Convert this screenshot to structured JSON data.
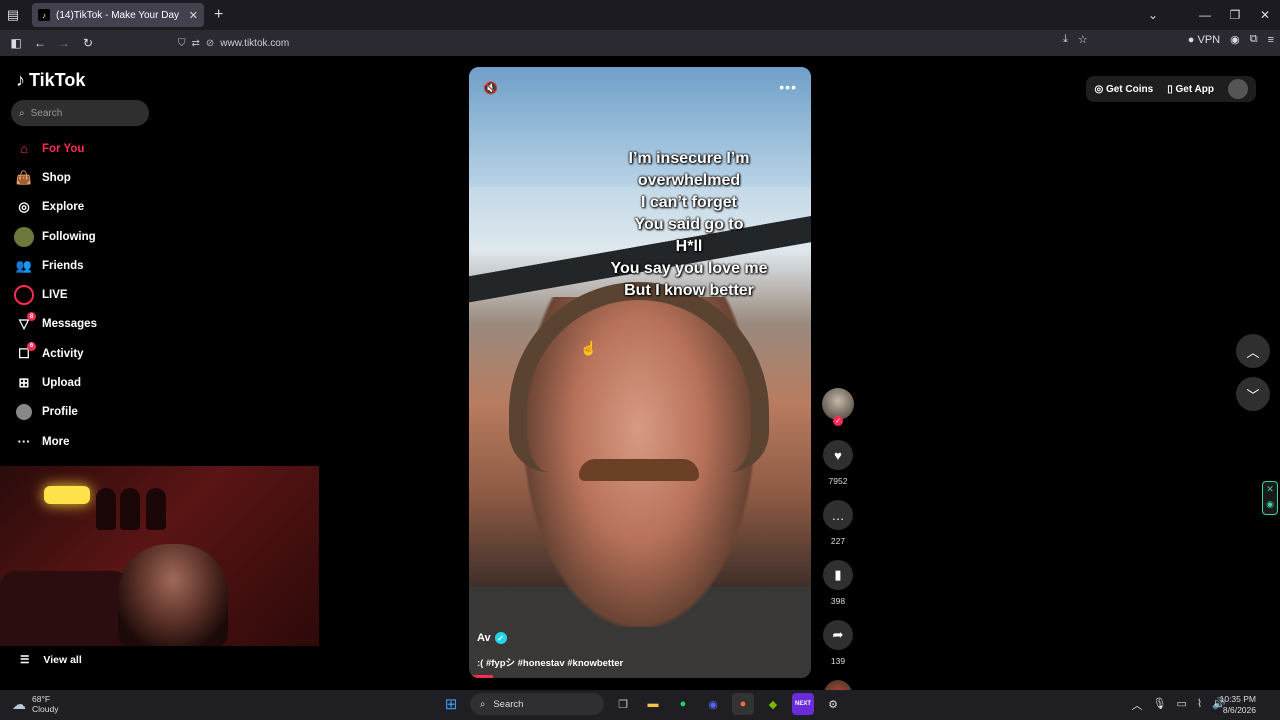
{
  "browser": {
    "tab_title": "(14)TikTok - Make Your Day",
    "url": "www.tiktok.com",
    "vpn_label": "VPN"
  },
  "sidebar": {
    "logo_text": "TikTok",
    "search_placeholder": "Search",
    "items": [
      {
        "label": "For You",
        "icon": "home-icon",
        "active": true
      },
      {
        "label": "Shop",
        "icon": "shop-bag-icon"
      },
      {
        "label": "Explore",
        "icon": "compass-icon"
      },
      {
        "label": "Following",
        "icon": "following-avatar-icon"
      },
      {
        "label": "Friends",
        "icon": "friends-icon"
      },
      {
        "label": "LIVE",
        "icon": "live-icon"
      },
      {
        "label": "Messages",
        "icon": "messages-icon",
        "badge": "8"
      },
      {
        "label": "Activity",
        "icon": "activity-icon",
        "badge": "6"
      },
      {
        "label": "Upload",
        "icon": "upload-icon"
      },
      {
        "label": "Profile",
        "icon": "profile-avatar-icon"
      },
      {
        "label": "More",
        "icon": "more-dots-icon"
      }
    ],
    "view_all": "View all"
  },
  "video": {
    "caption_lines": [
      "I’m insecure I’m",
      "overwhelmed",
      "I can’t forget",
      "You said go to",
      "H*ll",
      "You say you love me",
      "But I know better"
    ],
    "author": "Av",
    "description": ":( #fypシ #honestav #knowbetter"
  },
  "actions": {
    "likes": "7952",
    "comments": "227",
    "saves": "398",
    "shares": "139"
  },
  "topright": {
    "get_coins": "Get Coins",
    "get_app": "Get App"
  },
  "taskbar": {
    "temp": "68°F",
    "weather": "Cloudy",
    "search": "Search",
    "time": "10:35 PM",
    "date": "8/6/2026"
  },
  "colors": {
    "accent": "#fe2c55",
    "verified": "#20d5ec"
  }
}
